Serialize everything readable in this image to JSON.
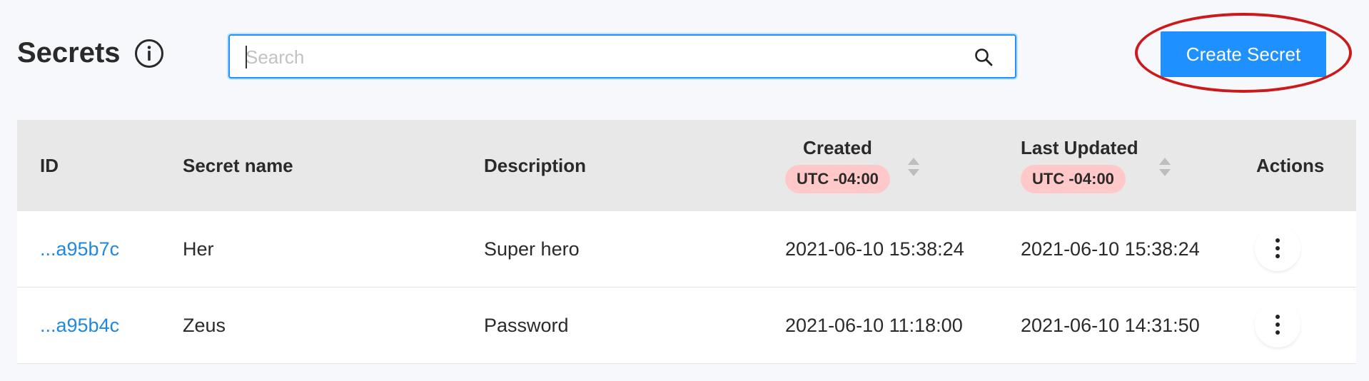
{
  "header": {
    "title": "Secrets",
    "info_icon": "info-circle-icon",
    "search": {
      "placeholder": "Search",
      "value": "",
      "icon": "search-icon"
    },
    "create_button_label": "Create Secret",
    "highlight_color": "#cc1a1a"
  },
  "table": {
    "columns": {
      "id": "ID",
      "name": "Secret name",
      "description": "Description",
      "created": "Created",
      "created_tz": "UTC -04:00",
      "updated": "Last Updated",
      "updated_tz": "UTC -04:00",
      "actions": "Actions"
    },
    "rows": [
      {
        "id": "...a95b7c",
        "name": "Her",
        "description": "Super hero",
        "created": "2021-06-10 15:38:24",
        "updated": "2021-06-10 15:38:24"
      },
      {
        "id": "...a95b4c",
        "name": "Zeus",
        "description": "Password",
        "created": "2021-06-10 11:18:00",
        "updated": "2021-06-10 14:31:50"
      }
    ]
  },
  "colors": {
    "accent": "#1e90ff",
    "link": "#1e88e5",
    "timezone_badge": "#ffc9c9",
    "header_bg": "#e8e8e8",
    "page_bg": "#f7f8fc"
  }
}
